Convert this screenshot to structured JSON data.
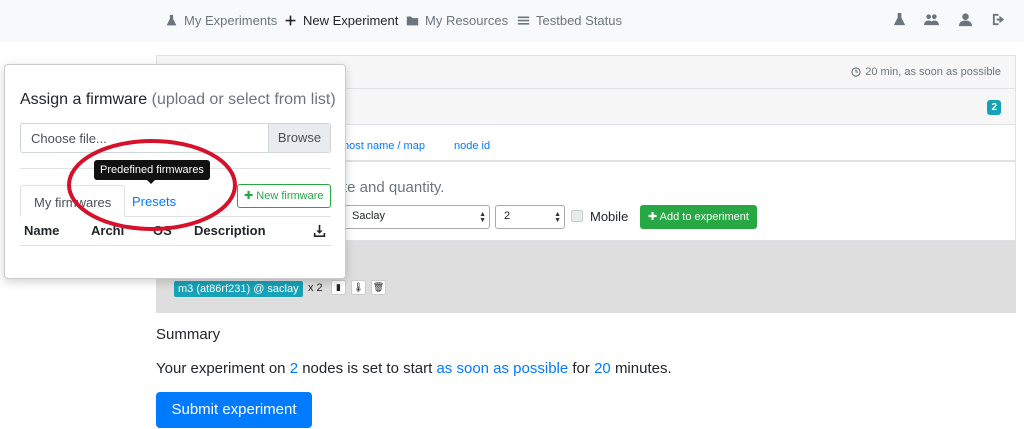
{
  "nav": {
    "items": [
      {
        "label": "My Experiments",
        "icon": "flask-icon"
      },
      {
        "label": "New Experiment",
        "icon": "plus-icon"
      },
      {
        "label": "My Resources",
        "icon": "folder-icon"
      },
      {
        "label": "Testbed Status",
        "icon": "list-icon"
      }
    ],
    "right_icons": [
      "flask-icon",
      "users-icon",
      "user-icon",
      "logout-icon"
    ]
  },
  "experiment": {
    "duration_text": "20 min, as soon as possible",
    "node_count_badge": "2",
    "tabs": [
      "host name / map",
      "node id"
    ],
    "instruction_fragment": "te and quantity.",
    "site_select": "Saclay",
    "quantity_select": "2",
    "mobile_label": "Mobile",
    "add_button": "Add to experiment",
    "selected_node": "m3 (at86rf231) @ saclay",
    "selected_multiplier": "x 2"
  },
  "summary": {
    "title": "Summary",
    "part1": "Your experiment on",
    "nodes": "2",
    "part2": "nodes is set to start",
    "start": "as soon as possible",
    "part3": "for",
    "minutes": "20",
    "part4": "minutes.",
    "submit_label": "Submit experiment"
  },
  "popover": {
    "title": "Assign a firmware",
    "title_hint": "(upload or select from list)",
    "file_placeholder": "Choose file...",
    "browse_label": "Browse",
    "tabs": [
      "My firmwares",
      "Presets"
    ],
    "new_firmware_label": "New firmware",
    "columns": [
      "Name",
      "Archi",
      "OS",
      "Description"
    ],
    "tooltip": "Predefined firmwares"
  },
  "colors": {
    "primary": "#007bff",
    "success": "#28a745",
    "info": "#17a2b8",
    "annotation_red": "#d6112a"
  }
}
